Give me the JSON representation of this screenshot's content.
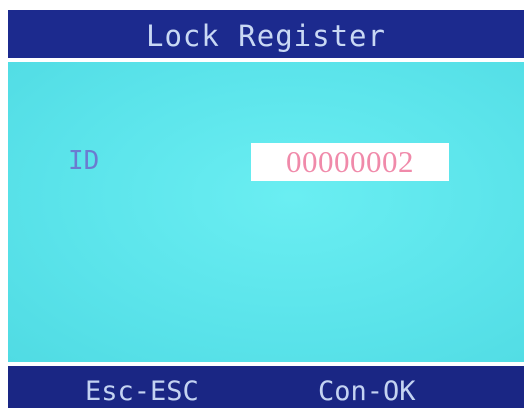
{
  "header": {
    "title": "Lock Register"
  },
  "form": {
    "id_label": "ID",
    "id_value": "00000002"
  },
  "footer": {
    "esc_label": "Esc-ESC",
    "ok_label": "Con-OK"
  },
  "colors": {
    "title_bar": "#1c2a8e",
    "content_bg": "#5fe7ec",
    "label_text": "#6b7bd0",
    "value_text": "#f08aaa",
    "footer_bar": "#1a2684"
  }
}
